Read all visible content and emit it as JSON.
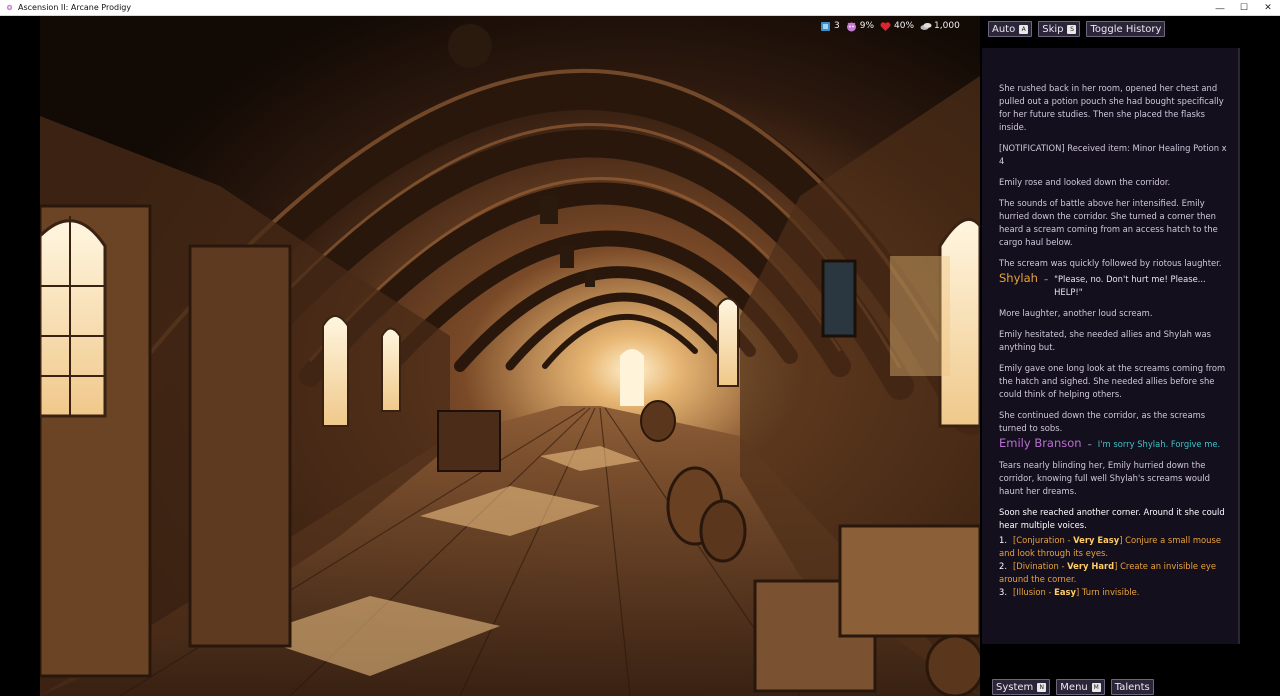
{
  "window": {
    "title": "Ascension II: Arcane Prodigy",
    "minimize": "—",
    "maximize": "☐",
    "close": "✕"
  },
  "hud": {
    "stat1": "3",
    "stat2": "9%",
    "stat3": "40%",
    "stat4": "1,000"
  },
  "buttons": {
    "auto": "Auto",
    "auto_key": "A",
    "skip": "Skip",
    "skip_key": "S",
    "history": "Toggle History",
    "system": "System",
    "system_key": "N",
    "menu": "Menu",
    "menu_key": "M",
    "talents": "Talents"
  },
  "history": {
    "p1": "She rushed back in her room, opened her chest and pulled out a potion pouch she had bought specifically for her future studies. Then she placed the flasks inside.",
    "p2": "[NOTIFICATION] Received item: Minor Healing Potion x 4",
    "p3": "Emily rose and looked down the corridor.",
    "p4": "The sounds of battle above her intensified. Emily hurried down the corridor. She turned a corner then heard a scream coming from an access hatch to the cargo haul below.",
    "p5": "The scream was quickly followed by riotous laughter.",
    "speaker1": "Shylah",
    "speaker1_line": "\"Please, no. Don't hurt me! Please... HELP!\"",
    "p6": "More laughter, another loud scream.",
    "p7": "Emily hesitated, she needed allies and Shylah was anything but.",
    "p8": "Emily gave one long look at the screams coming from the hatch and sighed. She needed allies before she could think of helping others.",
    "p9": "She continued down the corridor, as the screams turned to sobs.",
    "speaker2": "Emily Branson",
    "speaker2_line": "I'm sorry Shylah. Forgive me.",
    "p10": "Tears nearly blinding her, Emily hurried down the corridor, knowing full well Shylah's screams would haunt her dreams.",
    "dash": "–"
  },
  "current": {
    "text": "Soon she reached another corner. Around it she could hear multiple voices."
  },
  "choices": [
    {
      "num": "1.",
      "open": "[Conjuration - ",
      "difficulty": "Very Easy",
      "rest": "] Conjure a small mouse and look through its eyes."
    },
    {
      "num": "2.",
      "open": "[Divination - ",
      "difficulty": "Very Hard",
      "rest": "] Create an invisible eye around the corner."
    },
    {
      "num": "3.",
      "open": "[Illusion - ",
      "difficulty": "Easy",
      "rest": "] Turn invisible."
    }
  ],
  "colors": {
    "panel_bg": "#130f1d",
    "choice": "#e9a23b",
    "emily": "#b86fd0",
    "emily_quote": "#3fc0c8"
  }
}
